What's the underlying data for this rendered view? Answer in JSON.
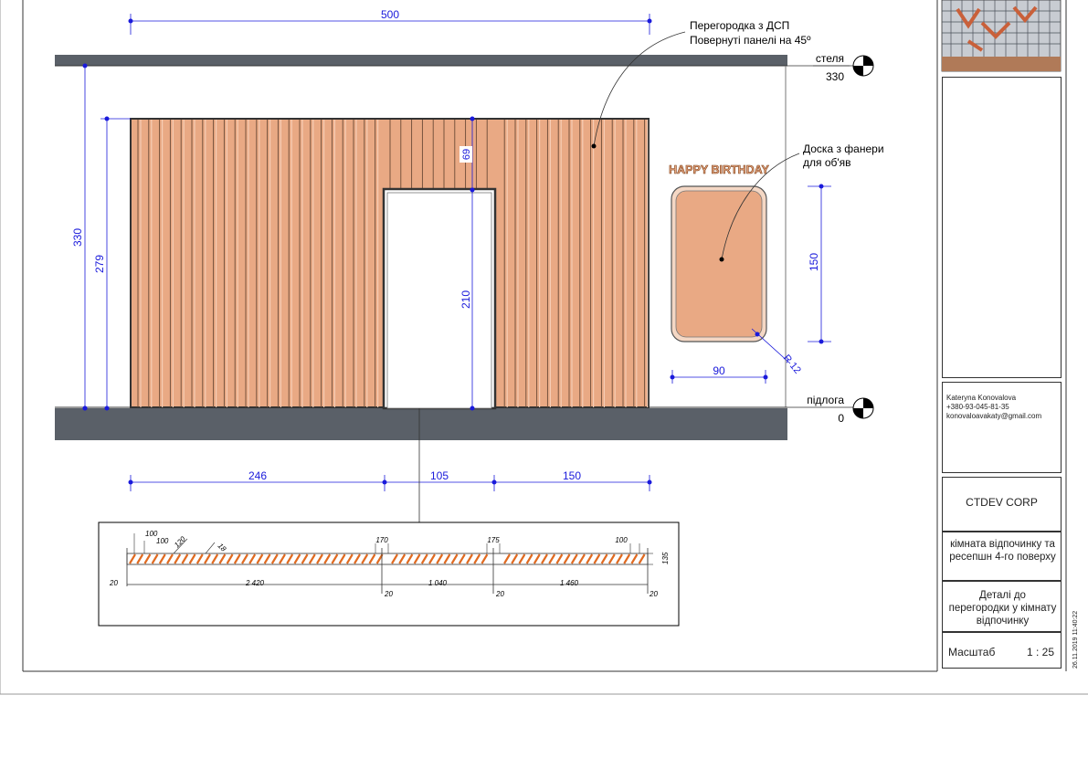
{
  "dimensions": {
    "width_500": "500",
    "height_330": "330",
    "height_279": "279",
    "height_69": "69",
    "door_210": "210",
    "board_150": "150",
    "board_90": "90",
    "radius": "R 12",
    "seg_246": "246",
    "seg_105": "105",
    "seg_150": "150"
  },
  "levels": {
    "ceiling_label": "стеля",
    "ceiling_value": "330",
    "floor_label": "підлога",
    "floor_value": "0"
  },
  "callouts": {
    "partition_line1": "Перегородка з ДСП",
    "partition_line2": "Повернуті панелі на 45º",
    "board_line1": "Доска з фанери",
    "board_line2": "для об'яв",
    "birthday_text": "HAPPY BIRTHDAY"
  },
  "plan_section": {
    "d100a": "100",
    "d100b": "100",
    "d120": "120",
    "d18": "18",
    "d170": "170",
    "d175": "175",
    "d100c": "100",
    "d135": "135",
    "end_left": "20",
    "seg1": "2 420",
    "j1": "20",
    "seg2": "1 040",
    "j2": "20",
    "seg3": "1 460",
    "end_right": "20"
  },
  "title_block": {
    "author_name": "Kateryna Konovalova",
    "author_phone": "+380-93-045-81-35",
    "author_email": "konovaloavakaty@gmail.com",
    "company": "CTDEV CORP",
    "project": "кімната відпочинку та ресепшн 4-го поверху",
    "sheet_title": "Деталі до перегородки у кімнату відпочинку",
    "scale_label": "Масштаб",
    "scale_value": "1 : 25",
    "timestamp": "26.11.2019 11:40:22"
  },
  "colors": {
    "wood": "#e9a984",
    "wood_dark": "#d48a60",
    "slab": "#5a6068",
    "dim_blue": "#1a1adb",
    "hatch_orange": "#e06a20"
  }
}
